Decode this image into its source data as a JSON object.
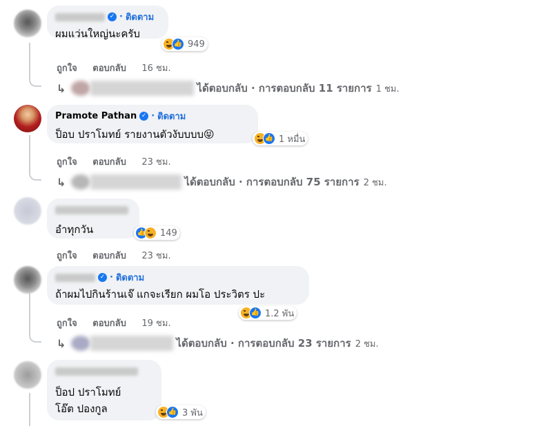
{
  "comments": [
    {
      "name": "",
      "follow_label": "ติดตาม",
      "text": "ผมแว่นใหญ่นะครับ",
      "reaction_count": "949",
      "actions": {
        "like": "ถูกใจ",
        "reply": "ตอบกลับ",
        "time": "16 ชม."
      },
      "replies": {
        "text": "ได้ตอบกลับ · การตอบกลับ 11 รายการ",
        "time": "1 ชม."
      }
    },
    {
      "name": "Pramote Pathan",
      "follow_label": "ติดตาม",
      "text": "ป็อบ ปราโมทย์ รายงานตัวงับบบบ😝",
      "reaction_count": "1 หมื่น",
      "actions": {
        "like": "ถูกใจ",
        "reply": "ตอบกลับ",
        "time": "23 ชม."
      },
      "replies": {
        "text": "ได้ตอบกลับ · การตอบกลับ 75 รายการ",
        "time": "2 ชม."
      }
    },
    {
      "name": "",
      "text": "อำทุกวัน",
      "reaction_count": "149",
      "actions": {
        "like": "ถูกใจ",
        "reply": "ตอบกลับ",
        "time": "23 ชม."
      }
    },
    {
      "name": "",
      "follow_label": "ติดตาม",
      "text": "ถ้าผมไปกินร้านเจ๊ แกจะเรียก ผมโอ ประวิตร ปะ",
      "reaction_count": "1.2 พัน",
      "actions": {
        "like": "ถูกใจ",
        "reply": "ตอบกลับ",
        "time": "19 ชม."
      },
      "replies": {
        "text": "ได้ตอบกลับ · การตอบกลับ 23 รายการ",
        "time": "2 ชม."
      }
    },
    {
      "name": "",
      "text": "ป็อป ปราโมทย์\nโอ๊ต ปองกูล",
      "reaction_count": "3 พัน"
    }
  ],
  "icons": {
    "verified": "verified-badge-icon",
    "like": "like-reaction-icon",
    "haha": "haha-reaction-icon",
    "reply_arrow": "reply-arrow-icon"
  },
  "colors": {
    "link": "#216fdb",
    "bubble": "#f0f2f5",
    "muted": "#65676b",
    "like": "#1877f2",
    "haha": "#f7b125"
  }
}
